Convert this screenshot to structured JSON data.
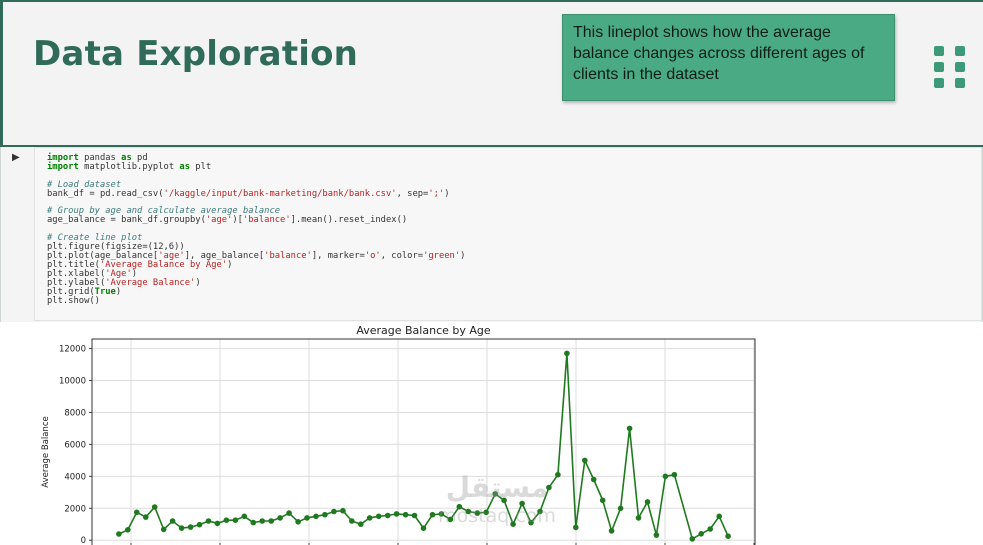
{
  "slide": {
    "title": "Data Exploration",
    "callout": "This lineplot shows how the average balance changes across different ages of clients in the dataset"
  },
  "code_lines": [
    [
      {
        "t": "import",
        "c": "kw"
      },
      {
        "t": " pandas ",
        "c": "nm"
      },
      {
        "t": "as",
        "c": "kw"
      },
      {
        "t": " pd",
        "c": "nm"
      }
    ],
    [
      {
        "t": "import",
        "c": "kw"
      },
      {
        "t": " matplotlib.pyplot ",
        "c": "nm"
      },
      {
        "t": "as",
        "c": "kw"
      },
      {
        "t": " plt",
        "c": "nm"
      }
    ],
    [],
    [
      {
        "t": "# Load dataset",
        "c": "cm"
      }
    ],
    [
      {
        "t": "bank_df = pd.read_csv(",
        "c": "nm"
      },
      {
        "t": "'/kaggle/input/bank-marketing/bank/bank.csv'",
        "c": "st"
      },
      {
        "t": ", sep=",
        "c": "nm"
      },
      {
        "t": "';'",
        "c": "st"
      },
      {
        "t": ")",
        "c": "nm"
      }
    ],
    [],
    [
      {
        "t": "# Group by age and calculate average balance",
        "c": "cm"
      }
    ],
    [
      {
        "t": "age_balance = bank_df.groupby(",
        "c": "nm"
      },
      {
        "t": "'age'",
        "c": "st"
      },
      {
        "t": ")[",
        "c": "nm"
      },
      {
        "t": "'balance'",
        "c": "st"
      },
      {
        "t": "].mean().reset_index()",
        "c": "nm"
      }
    ],
    [],
    [
      {
        "t": "# Create line plot",
        "c": "cm"
      }
    ],
    [
      {
        "t": "plt.figure(figsize=(12,6))",
        "c": "nm"
      }
    ],
    [
      {
        "t": "plt.plot(age_balance[",
        "c": "nm"
      },
      {
        "t": "'age'",
        "c": "st"
      },
      {
        "t": "], age_balance[",
        "c": "nm"
      },
      {
        "t": "'balance'",
        "c": "st"
      },
      {
        "t": "], marker=",
        "c": "nm"
      },
      {
        "t": "'o'",
        "c": "st"
      },
      {
        "t": ", color=",
        "c": "nm"
      },
      {
        "t": "'green'",
        "c": "st"
      },
      {
        "t": ")",
        "c": "nm"
      }
    ],
    [
      {
        "t": "plt.title(",
        "c": "nm"
      },
      {
        "t": "'Average Balance by Age'",
        "c": "st"
      },
      {
        "t": ")",
        "c": "nm"
      }
    ],
    [
      {
        "t": "plt.xlabel(",
        "c": "nm"
      },
      {
        "t": "'Age'",
        "c": "st"
      },
      {
        "t": ")",
        "c": "nm"
      }
    ],
    [
      {
        "t": "plt.ylabel(",
        "c": "nm"
      },
      {
        "t": "'Average Balance'",
        "c": "st"
      },
      {
        "t": ")",
        "c": "nm"
      }
    ],
    [
      {
        "t": "plt.grid(",
        "c": "nm"
      },
      {
        "t": "True",
        "c": "kw"
      },
      {
        "t": ")",
        "c": "nm"
      }
    ],
    [
      {
        "t": "plt.show()",
        "c": "nm"
      }
    ]
  ],
  "watermark": {
    "arabic": "مستقل",
    "latin": "mostaq.com"
  },
  "chart_data": {
    "type": "line",
    "title": "Average Balance by Age",
    "xlabel": "",
    "ylabel": "Average Balance",
    "yticks": [
      0,
      2000,
      4000,
      6000,
      8000,
      10000,
      12000
    ],
    "ylim": [
      -300,
      12600
    ],
    "xlim": [
      16,
      90
    ],
    "grid": true,
    "color": "#1f7a1f",
    "series": [
      {
        "x": [
          19,
          20,
          21,
          22,
          23,
          24,
          25,
          26,
          27,
          28,
          29,
          30,
          31,
          32,
          33,
          34,
          35,
          36,
          37,
          38,
          39,
          40,
          41,
          42,
          43,
          44,
          45,
          46,
          47,
          48,
          49,
          50,
          51,
          52,
          53,
          54,
          55,
          56,
          57,
          58,
          59,
          60,
          61,
          62,
          63,
          64,
          65,
          66,
          67,
          68,
          69,
          70,
          71,
          72,
          73,
          74,
          75,
          76,
          77,
          78,
          79,
          80,
          81,
          83,
          84,
          85,
          86,
          87
        ],
        "y": [
          390,
          650,
          1750,
          1450,
          2080,
          680,
          1200,
          760,
          820,
          970,
          1200,
          1050,
          1250,
          1250,
          1500,
          1100,
          1200,
          1200,
          1400,
          1700,
          1150,
          1400,
          1500,
          1600,
          1800,
          1850,
          1200,
          1000,
          1400,
          1500,
          1550,
          1650,
          1600,
          1550,
          750,
          1600,
          1650,
          1300,
          2100,
          1800,
          1700,
          1750,
          2900,
          2500,
          1000,
          2300,
          1100,
          1800,
          3300,
          4100,
          11700,
          800,
          5000,
          3800,
          2500,
          580,
          2000,
          7000,
          1400,
          2400,
          320,
          4000,
          4100,
          80,
          400,
          700,
          1500,
          250
        ]
      }
    ]
  }
}
